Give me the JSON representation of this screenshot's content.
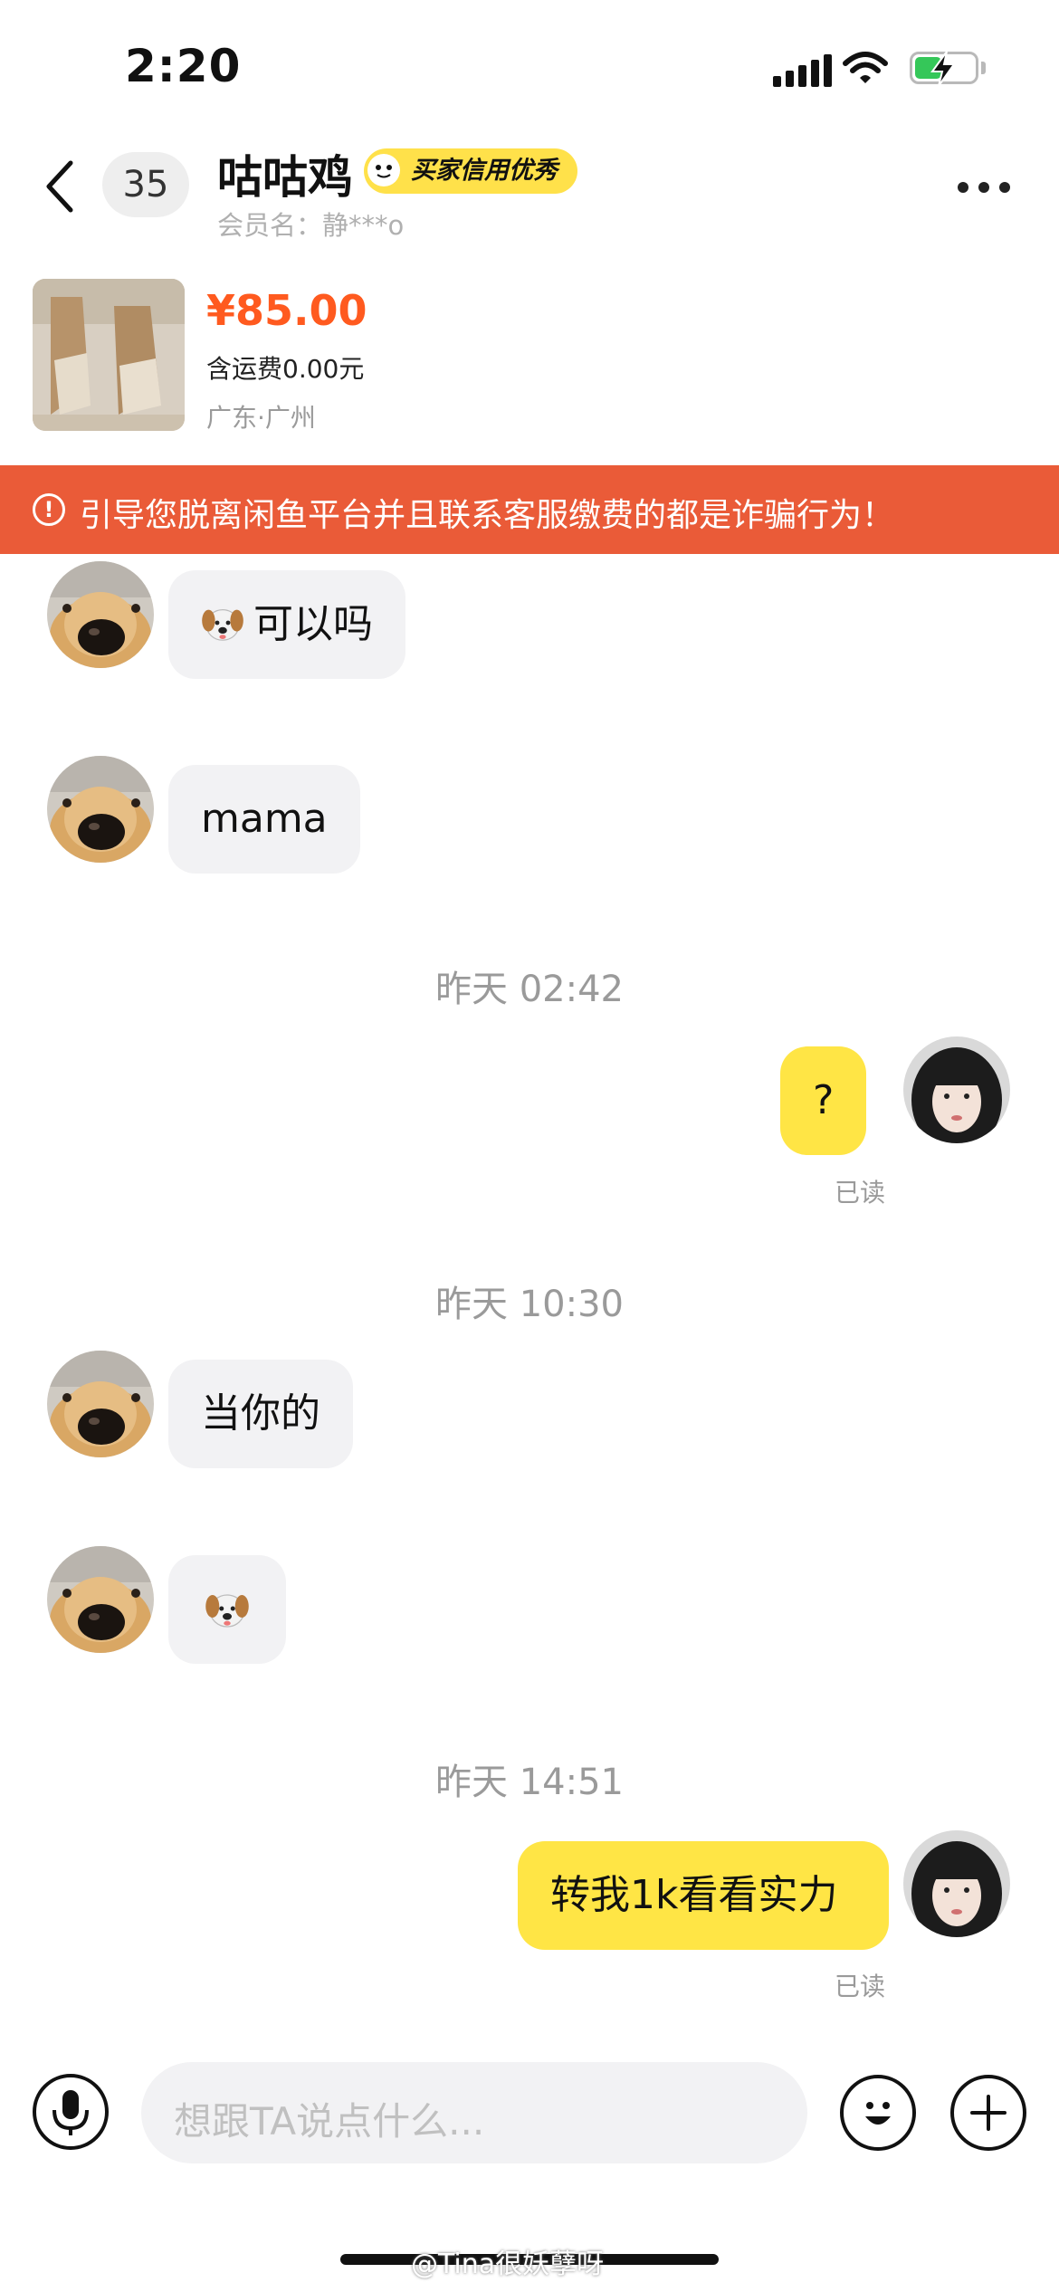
{
  "status_bar": {
    "time": "2:20"
  },
  "header": {
    "unread_count": "35",
    "contact_name": "咕咕鸡",
    "badge": "买家信用优秀",
    "member_label": "会员名：静***o"
  },
  "product": {
    "price": "¥85.00",
    "shipping": "含运费0.00元",
    "location": "广东·广州"
  },
  "warning": "引导您脱离闲鱼平台并且联系客服缴费的都是诈骗行为！",
  "messages": {
    "m1": "可以吗",
    "m2": "mama",
    "t1": "昨天 02:42",
    "m3": "?",
    "r1": "已读",
    "t2": "昨天 10:30",
    "m4": "当你的",
    "t3": "昨天 14:51",
    "m6": "转我1k看看实力",
    "r2": "已读"
  },
  "input": {
    "placeholder": "想跟TA说点什么..."
  },
  "watermark": "@Tina很妖孽呀",
  "colors": {
    "accent_yellow": "#ffe545",
    "price_orange": "#ff5a1f",
    "warning_bg": "#ea5b38"
  },
  "icons": [
    "back-icon",
    "more-icon",
    "mic-icon",
    "emoji-icon",
    "plus-icon",
    "dog-emoji-icon"
  ]
}
